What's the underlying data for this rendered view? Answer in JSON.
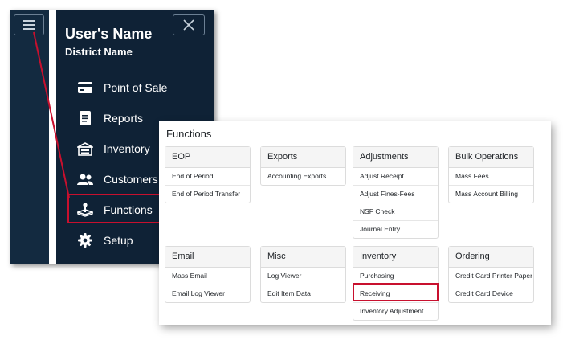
{
  "nav": {
    "user_name": "User's Name",
    "district_name": "District Name",
    "items": [
      {
        "label": "Point of Sale",
        "icon": "point-of-sale-icon"
      },
      {
        "label": "Reports",
        "icon": "reports-icon"
      },
      {
        "label": "Inventory",
        "icon": "inventory-icon"
      },
      {
        "label": "Customers",
        "icon": "customers-icon"
      },
      {
        "label": "Functions",
        "icon": "functions-icon"
      },
      {
        "label": "Setup",
        "icon": "setup-icon"
      }
    ]
  },
  "functions": {
    "title": "Functions",
    "groups": [
      {
        "title": "EOP",
        "items": [
          "End of Period",
          "End of Period Transfer"
        ]
      },
      {
        "title": "Exports",
        "items": [
          "Accounting Exports"
        ]
      },
      {
        "title": "Adjustments",
        "items": [
          "Adjust Receipt",
          "Adjust Fines-Fees",
          "NSF Check",
          "Journal Entry"
        ]
      },
      {
        "title": "Bulk Operations",
        "items": [
          "Mass Fees",
          "Mass Account Billing"
        ]
      },
      {
        "title": "Email",
        "items": [
          "Mass Email",
          "Email Log Viewer"
        ]
      },
      {
        "title": "Misc",
        "items": [
          "Log Viewer",
          "Edit Item Data"
        ]
      },
      {
        "title": "Inventory",
        "items": [
          "Purchasing",
          "Receiving",
          "Inventory Adjustment"
        ]
      },
      {
        "title": "Ordering",
        "items": [
          "Credit Card Printer Paper",
          "Credit Card Device"
        ]
      }
    ]
  },
  "colors": {
    "nav_background": "#132a40",
    "highlight": "#c8102e"
  }
}
